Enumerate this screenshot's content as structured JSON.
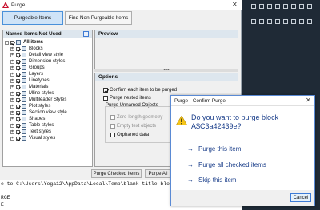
{
  "purge": {
    "title": "Purge",
    "close": "✕",
    "tabs": [
      "Purgeable Items",
      "Find Non-Purgeable Items"
    ],
    "items_header": "Named Items Not Used",
    "tree": [
      {
        "label": "All items",
        "checked": true
      },
      {
        "label": "Blocks",
        "checked": true
      },
      {
        "label": "Detail view style",
        "checked": true
      },
      {
        "label": "Dimension styles",
        "checked": true
      },
      {
        "label": "Groups",
        "checked": true
      },
      {
        "label": "Layers",
        "checked": true
      },
      {
        "label": "Linetypes",
        "checked": true
      },
      {
        "label": "Materials",
        "checked": true
      },
      {
        "label": "Mline styles",
        "checked": true
      },
      {
        "label": "Multileader Styles",
        "checked": true
      },
      {
        "label": "Plot styles",
        "checked": true
      },
      {
        "label": "Section view style",
        "checked": true
      },
      {
        "label": "Shapes",
        "checked": true
      },
      {
        "label": "Table styles",
        "checked": true
      },
      {
        "label": "Text styles",
        "checked": true
      },
      {
        "label": "Visual styles",
        "checked": true
      }
    ],
    "preview_header": "Preview",
    "splitter": "••••",
    "options_header": "Options",
    "options": {
      "confirm": "Confirm each item to be purged",
      "nested": "Purge nested items",
      "group_label": "Purge Unnamed Objects",
      "zero_length": "Zero-length geometry",
      "empty_text": "Empty text objects",
      "orphaned": "Orphaned data"
    },
    "buttons": {
      "purge_checked": "Purge Checked Items",
      "purge_all": "Purge All"
    }
  },
  "command_line": {
    "line1": "e to C:\\Users\\Yoga12\\AppData\\Local\\Temp\\blank title block ve",
    "line2": "RGE",
    "line3": "E"
  },
  "confirm_dialog": {
    "title": "Purge - Confirm Purge",
    "close": "✕",
    "question": "Do you want to purge block A$C3a42439e?",
    "arrow": "→",
    "commands": [
      "Purge this item",
      "Purge all checked items",
      "Skip this item"
    ],
    "cancel": "Cancel"
  },
  "colors": {
    "accent": "#3e7bd4",
    "link": "#1a3e8a",
    "warning": "#f5c518"
  }
}
